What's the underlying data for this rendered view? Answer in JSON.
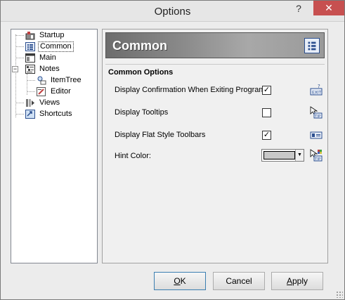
{
  "window": {
    "title": "Options",
    "help_glyph": "?",
    "close_glyph": "✕"
  },
  "tree": {
    "items": [
      {
        "label": "Startup",
        "icon": "startup-icon"
      },
      {
        "label": "Common",
        "icon": "common-icon",
        "selected": true
      },
      {
        "label": "Main",
        "icon": "main-icon"
      },
      {
        "label": "Notes",
        "icon": "notes-icon",
        "expanded": true
      },
      {
        "label": "ItemTree",
        "icon": "itemtree-icon"
      },
      {
        "label": "Editor",
        "icon": "editor-icon"
      },
      {
        "label": "Views",
        "icon": "views-icon"
      },
      {
        "label": "Shortcuts",
        "icon": "shortcuts-icon"
      }
    ],
    "expander_minus": "−",
    "expander_plus": "+"
  },
  "panel": {
    "banner_title": "Common",
    "group_title": "Common Options",
    "options": [
      {
        "label": "Display Confirmation When Exiting Program:",
        "checked": true,
        "icon": "exit-icon"
      },
      {
        "label": "Display Tooltips",
        "checked": false,
        "icon": "tip-icon"
      },
      {
        "label": "Display Flat Style Toolbars",
        "checked": true,
        "icon": "toolbar-icon"
      }
    ],
    "hint_color_label": "Hint Color:",
    "hint_color_value": "#c8c8c8",
    "check_glyph": "✓",
    "combo_arrow": "▼"
  },
  "buttons": {
    "ok": {
      "label_accel": "O",
      "label_rest": "K"
    },
    "cancel": {
      "label": "Cancel"
    },
    "apply": {
      "label_accel": "A",
      "label_rest": "pply"
    }
  }
}
